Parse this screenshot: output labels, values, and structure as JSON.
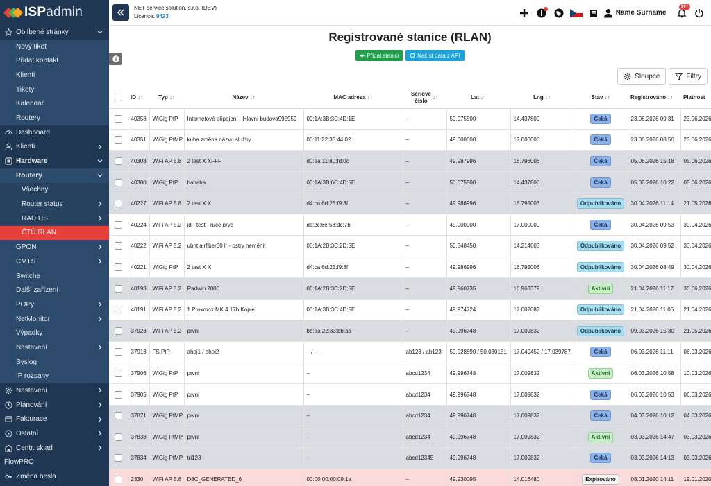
{
  "app": {
    "logo_bold": "ISP",
    "logo_light": "admin"
  },
  "topbar": {
    "company": "NET service solution, s.r.o. (DEV)",
    "licence_label": "Licence:",
    "licence_number": "9423",
    "username": "Name Surname",
    "notif_badge": "99+"
  },
  "sidebar": {
    "items": [
      {
        "label": "Oblíbené stránky",
        "level": 0,
        "icon": "star-icon",
        "chevron": "down"
      },
      {
        "label": "Nový tiket",
        "level": 1
      },
      {
        "label": "Přidat kontakt",
        "level": 1
      },
      {
        "label": "Klienti",
        "level": 1
      },
      {
        "label": "Tikety",
        "level": 1
      },
      {
        "label": "Kalendář",
        "level": 1
      },
      {
        "label": "Routery",
        "level": 1
      },
      {
        "label": "Dashboard",
        "level": 0,
        "icon": "dashboard-icon"
      },
      {
        "label": "Klienti",
        "level": 0,
        "icon": "user-icon",
        "chevron": "right"
      },
      {
        "label": "Hardware",
        "level": 0,
        "icon": "hardware-icon",
        "chevron": "down",
        "bold": true
      },
      {
        "label": "Routery",
        "level": 2,
        "chevron": "down",
        "bold": true
      },
      {
        "label": "Všechny",
        "level": 3
      },
      {
        "label": "Router status",
        "level": 3,
        "chevron": "right"
      },
      {
        "label": "RADIUS",
        "level": 3,
        "chevron": "right"
      },
      {
        "label": "ČTÚ RLAN",
        "level": 3,
        "active": true
      },
      {
        "label": "GPON",
        "level": 1,
        "chevron": "right"
      },
      {
        "label": "CMTS",
        "level": 1,
        "chevron": "right"
      },
      {
        "label": "Switche",
        "level": 1
      },
      {
        "label": "Další zařízení",
        "level": 1
      },
      {
        "label": "POPy",
        "level": 1,
        "chevron": "right"
      },
      {
        "label": "NetMonitor",
        "level": 1,
        "chevron": "right"
      },
      {
        "label": "Výpadky",
        "level": 1
      },
      {
        "label": "Nastavení",
        "level": 1,
        "chevron": "right"
      },
      {
        "label": "Syslog",
        "level": 1
      },
      {
        "label": "IP rozsahy",
        "level": 1
      },
      {
        "label": "Nastavení",
        "level": 0,
        "icon": "gear-icon",
        "chevron": "right"
      },
      {
        "label": "Plánování",
        "level": 0,
        "icon": "clock-icon",
        "chevron": "right"
      },
      {
        "label": "Fakturace",
        "level": 0,
        "icon": "invoice-icon",
        "chevron": "right"
      },
      {
        "label": "Ostatní",
        "level": 0,
        "icon": "circle-icon",
        "chevron": "right"
      },
      {
        "label": "Centr. sklad",
        "level": 0,
        "icon": "warehouse-icon",
        "chevron": "right"
      },
      {
        "label": "FlowPRO",
        "level": 0
      },
      {
        "label": "Změna hesla",
        "level": 0,
        "icon": "key-icon"
      }
    ]
  },
  "main": {
    "title": "Registrované stanice (RLAN)",
    "add_button": "Přidat stanici",
    "load_button": "Načíst data z API",
    "columns_button": "Sloupce",
    "filters_button": "Filtry"
  },
  "table": {
    "headers": {
      "id": "ID",
      "typ": "Typ",
      "nazev": "Název",
      "mac": "MAC adresa",
      "serial_1": "Sériové",
      "serial_2": "číslo",
      "lat": "Lat",
      "lng": "Lng",
      "stav": "Stav",
      "registrovano": "Registrováno",
      "platnost": "Platnost"
    },
    "rows": [
      {
        "id": "40358",
        "typ": "WiGig PtP",
        "nazev": "Internetové připojení - Hlavní budova995959",
        "mac": "00:1A:3B:3C:4D:1E",
        "serial": "–",
        "lat": "50.075500",
        "lng": "14.437800",
        "stav": "Čeká",
        "stav_type": "ceka",
        "reg": "23.06.2026 09:31",
        "plat": "23.06.2026",
        "shade": "white"
      },
      {
        "id": "40351",
        "typ": "WiGig PtMP",
        "nazev": "kuba změna názvu služby",
        "mac": "00:11:22:33:44:02",
        "serial": "–",
        "lat": "49.000000",
        "lng": "17.000000",
        "stav": "Čeká",
        "stav_type": "ceka",
        "reg": "23.06.2026 08:50",
        "plat": "23.06.2026",
        "shade": "white"
      },
      {
        "id": "40308",
        "typ": "WiFi AP 5.8",
        "nazev": "2 test X XFFF",
        "mac": "d0:ea:11:80:fd:0c",
        "serial": "–",
        "lat": "49.987996",
        "lng": "16.796006",
        "stav": "Čeká",
        "stav_type": "ceka",
        "reg": "05.06.2026 15:18",
        "plat": "05.06.2026",
        "shade": "gray"
      },
      {
        "id": "40300",
        "typ": "WiGig PtP",
        "nazev": "hahaha",
        "mac": "00:1A:3B:6C:4D:5E",
        "serial": "–",
        "lat": "50.075500",
        "lng": "14.437800",
        "stav": "Čeká",
        "stav_type": "ceka",
        "reg": "05.06.2026 10:22",
        "plat": "05.06.2026",
        "shade": "gray"
      },
      {
        "id": "40227",
        "typ": "WiFi AP 5.8",
        "nazev": "2 test X X",
        "mac": "d4:ca:6d:25:f9:8f",
        "serial": "–",
        "lat": "49.986996",
        "lng": "16.795006",
        "stav": "Odpublikováno",
        "stav_type": "odpub",
        "reg": "30.04.2026 11:14",
        "plat": "21.05.2026",
        "shade": "gray"
      },
      {
        "id": "40224",
        "typ": "WiFi AP 5.2",
        "nazev": "jd - test - ruce pryč",
        "mac": "dc:2c:6e:58:dc:7b",
        "serial": "–",
        "lat": "49.000000",
        "lng": "17.000000",
        "stav": "Čeká",
        "stav_type": "ceka",
        "reg": "30.04.2026 09:53",
        "plat": "30.04.2026",
        "shade": "white"
      },
      {
        "id": "40222",
        "typ": "WiFi AP 5.2",
        "nazev": "ubnt airfiber60 lr - ostry neměnit",
        "mac": "00:1A:2B:3C:2D:5E",
        "serial": "–",
        "lat": "50.848450",
        "lng": "14.214603",
        "stav": "Odpublikováno",
        "stav_type": "odpub",
        "reg": "30.04.2026 09:52",
        "plat": "30.04.2026",
        "shade": "white"
      },
      {
        "id": "40221",
        "typ": "WiGig PtP",
        "nazev": "2 test X X",
        "mac": "d4:ca:6d:25:f9:8f",
        "serial": "–",
        "lat": "49.986996",
        "lng": "16.795006",
        "stav": "Odpublikováno",
        "stav_type": "odpub",
        "reg": "30.04.2026 08:49",
        "plat": "30.04.2026",
        "shade": "white"
      },
      {
        "id": "40193",
        "typ": "WiFi AP 5.2",
        "nazev": "Radwin 2000",
        "mac": "00:1A:2B:3C:2D:5E",
        "serial": "–",
        "lat": "49.960735",
        "lng": "16.963379",
        "stav": "Aktivní",
        "stav_type": "aktiv",
        "reg": "21.04.2026 11:17",
        "plat": "30.06.2026",
        "shade": "gray"
      },
      {
        "id": "40191",
        "typ": "WiFi AP 5.2",
        "nazev": "1 Proxmox MK 4.17b Kopie",
        "mac": "00:1A:3B:3C:4D:5E",
        "serial": "–",
        "lat": "49.974724",
        "lng": "17.002087",
        "stav": "Odpublikováno",
        "stav_type": "odpub",
        "reg": "21.04.2026 11:06",
        "plat": "21.04.2026",
        "shade": "white"
      },
      {
        "id": "37923",
        "typ": "WiFi AP 5.2",
        "nazev": "prvni",
        "mac": "bb:aa:22:33:bb:aa",
        "serial": "–",
        "lat": "49.996748",
        "lng": "17.009832",
        "stav": "Odpublikováno",
        "stav_type": "odpub",
        "reg": "09.03.2026 15:30",
        "plat": "21.05.2026",
        "shade": "gray"
      },
      {
        "id": "37913",
        "typ": "FS PtP",
        "nazev": "ahoj1 / ahoj2",
        "mac": "– / –",
        "serial": "ab123 / ab123",
        "lat": "50.028890 / 50.030151",
        "lng": "17.040452 / 17.039787",
        "stav": "Čeká",
        "stav_type": "ceka",
        "reg": "06.03.2026 11:11",
        "plat": "06.03.2026",
        "shade": "white"
      },
      {
        "id": "37906",
        "typ": "WiGig PtP",
        "nazev": "prvni",
        "mac": "–",
        "serial": "abcd1234",
        "lat": "49.996748",
        "lng": "17.009832",
        "stav": "Aktivní",
        "stav_type": "aktiv",
        "reg": "06.03.2026 10:58",
        "plat": "10.03.2026",
        "shade": "white"
      },
      {
        "id": "37905",
        "typ": "WiGig PtP",
        "nazev": "prvni",
        "mac": "–",
        "serial": "abcd1234",
        "lat": "49.996748",
        "lng": "17.009832",
        "stav": "Čeká",
        "stav_type": "ceka",
        "reg": "06.03.2026 10:53",
        "plat": "06.03.2026",
        "shade": "white"
      },
      {
        "id": "37871",
        "typ": "WiGig PtMP",
        "nazev": "prvni",
        "mac": "–",
        "serial": "abcd1234",
        "lat": "49.996748",
        "lng": "17.009832",
        "stav": "Čeká",
        "stav_type": "ceka",
        "reg": "04.03.2026 10:12",
        "plat": "04.03.2026",
        "shade": "gray"
      },
      {
        "id": "37838",
        "typ": "WiGig PtMP",
        "nazev": "prvni",
        "mac": "–",
        "serial": "abcd1234",
        "lat": "49.996748",
        "lng": "17.009832",
        "stav": "Aktivní",
        "stav_type": "aktiv",
        "reg": "03.03.2026 14:47",
        "plat": "03.03.2026",
        "shade": "gray"
      },
      {
        "id": "37834",
        "typ": "WiGig PtMP",
        "nazev": "tri123",
        "mac": "–",
        "serial": "abcd12345",
        "lat": "49.996748",
        "lng": "17.009832",
        "stav": "Čeká",
        "stav_type": "ceka",
        "reg": "03.03.2026 14:13",
        "plat": "03.03.2026",
        "shade": "gray"
      },
      {
        "id": "2330",
        "typ": "WiFi AP 5.8",
        "nazev": "D8C_GENERATED_6",
        "mac": "00:00:00:00:09:1a",
        "serial": "–",
        "lat": "49.930095",
        "lng": "14.016480",
        "stav": "Expirováno",
        "stav_type": "exp",
        "reg": "08.01.2020 14:11",
        "plat": "19.01.2020",
        "shade": "pink"
      }
    ]
  },
  "colors": {
    "sidebar_bg": "#1f3752",
    "sidebar_sub_bg": "#2c4a6b",
    "active": "#e8403a",
    "green": "#1e9e4a",
    "blue": "#1aa3d8"
  }
}
